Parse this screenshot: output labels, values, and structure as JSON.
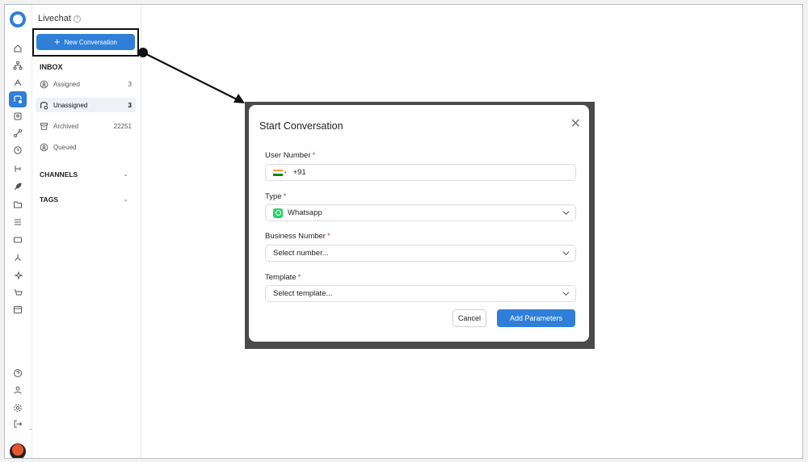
{
  "app": {
    "title": "Livechat"
  },
  "sidebar": {
    "new_conversation_label": "New Conversation",
    "inbox_heading": "INBOX",
    "items": [
      {
        "label": "Assigned",
        "count": "3"
      },
      {
        "label": "Unassigned",
        "count": "3"
      },
      {
        "label": "Archived",
        "count": "22251"
      },
      {
        "label": "Queued",
        "count": ""
      }
    ],
    "channels_label": "CHANNELS",
    "tags_label": "TAGS"
  },
  "rail_icons": [
    "home-icon",
    "hierarchy-icon",
    "broadcast-icon",
    "chat-icon",
    "contacts-icon",
    "flows-icon",
    "clock-icon",
    "branch-icon",
    "rocket-icon",
    "folder-icon",
    "filters-icon",
    "ticket-icon",
    "integration-icon",
    "sparkles-icon",
    "cart-icon",
    "calendar-icon",
    "help-icon",
    "users-icon",
    "settings-icon",
    "logout-icon"
  ],
  "modal": {
    "title": "Start Conversation",
    "user_number_label": "User Number",
    "user_number_value": "+91",
    "type_label": "Type",
    "type_value": "Whatsapp",
    "business_number_label": "Business Number",
    "business_number_placeholder": "Select number...",
    "template_label": "Template",
    "template_placeholder": "Select template...",
    "required_mark": "*",
    "cancel_label": "Cancel",
    "add_parameters_label": "Add Parameters"
  },
  "colors": {
    "accent": "#2f7fd8",
    "whatsapp": "#25d366",
    "required": "#e03030"
  }
}
